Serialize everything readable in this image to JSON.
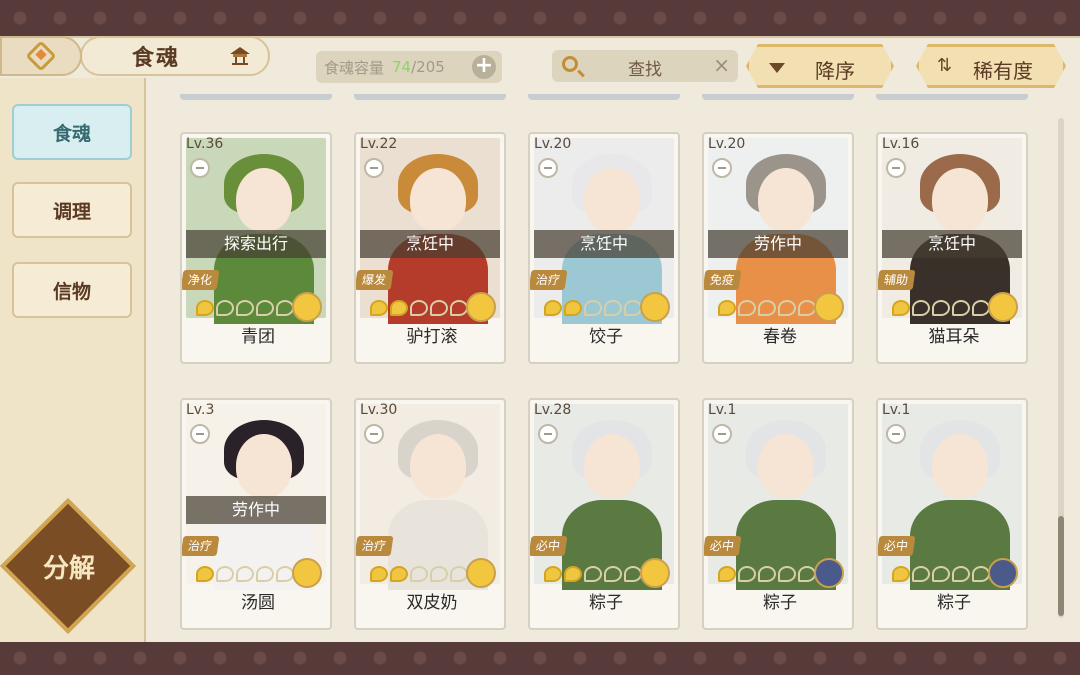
{
  "header": {
    "title": "食魂",
    "capacity_label": "食魂容量",
    "capacity_current": "74",
    "capacity_max": "/205",
    "capacity_plus": "+",
    "search_label": "查找",
    "search_clear": "×",
    "sort_label": "降序",
    "rarity_label": "稀有度",
    "rarity_arrows": "⇅"
  },
  "sidebar": {
    "tabs": [
      {
        "label": "食魂",
        "active": true
      },
      {
        "label": "调理",
        "active": false
      },
      {
        "label": "信物",
        "active": false
      }
    ],
    "decompose_label": "分解"
  },
  "cards": [
    {
      "level": "Lv.36",
      "status": "探索出行",
      "role": "净化",
      "stars": 1,
      "name": "青团",
      "hair": "#6a8f3a",
      "body": "#5c8a3a",
      "bg": "#c8d8b8",
      "medal": "#f3c640"
    },
    {
      "level": "Lv.22",
      "status": "烹饪中",
      "role": "爆发",
      "stars": 2,
      "name": "驴打滚",
      "hair": "#c98a3a",
      "body": "#b53b2a",
      "bg": "#eadfd0",
      "medal": "#f3c640"
    },
    {
      "level": "Lv.20",
      "status": "烹饪中",
      "role": "治疗",
      "stars": 2,
      "name": "饺子",
      "hair": "#e8e8ea",
      "body": "#9cc8d4",
      "bg": "#ececec",
      "medal": "#f3c640"
    },
    {
      "level": "Lv.20",
      "status": "劳作中",
      "role": "免疫",
      "stars": 1,
      "name": "春卷",
      "hair": "#9a948a",
      "body": "#e89048",
      "bg": "#eef0f0",
      "medal": "#f3c640"
    },
    {
      "level": "Lv.16",
      "status": "烹饪中",
      "role": "辅助",
      "stars": 1,
      "name": "猫耳朵",
      "hair": "#9a6a4a",
      "body": "#3a302a",
      "bg": "#f0ece4",
      "medal": "#f3c640"
    },
    {
      "level": "Lv.3",
      "status": "劳作中",
      "role": "治疗",
      "stars": 1,
      "name": "汤圆",
      "hair": "#2a2228",
      "body": "#f4f2f0",
      "bg": "#f6f2ea",
      "medal": "#f3c640"
    },
    {
      "level": "Lv.30",
      "status": "",
      "role": "治疗",
      "stars": 2,
      "name": "双皮奶",
      "hair": "#d8d4cc",
      "body": "#e8e4dc",
      "bg": "#f2ece2",
      "medal": "#f3c640"
    },
    {
      "level": "Lv.28",
      "status": "",
      "role": "必中",
      "stars": 2,
      "name": "粽子",
      "hair": "#e2e4e6",
      "body": "#5a7a42",
      "bg": "#e8eae6",
      "medal": "#f3c640"
    },
    {
      "level": "Lv.1",
      "status": "",
      "role": "必中",
      "stars": 1,
      "name": "粽子",
      "hair": "#e2e4e6",
      "body": "#5a7a42",
      "bg": "#e8eae6",
      "medal": "#4a5a8a"
    },
    {
      "level": "Lv.1",
      "status": "",
      "role": "必中",
      "stars": 1,
      "name": "粽子",
      "hair": "#e2e4e6",
      "body": "#5a7a42",
      "bg": "#e8eae6",
      "medal": "#4a5a8a"
    }
  ]
}
